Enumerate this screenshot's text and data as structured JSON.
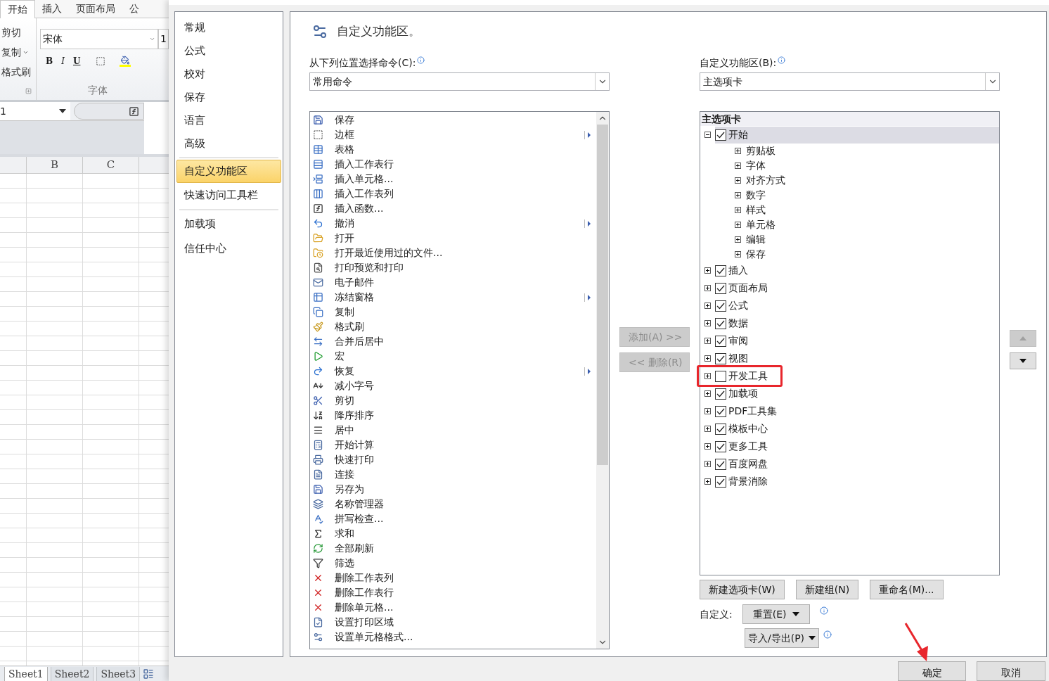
{
  "excel": {
    "ribbon_tabs": [
      {
        "label": "开始",
        "selected": true
      },
      {
        "label": "插入",
        "selected": false
      },
      {
        "label": "页面布局",
        "selected": false
      },
      {
        "label": "公",
        "selected": false
      }
    ],
    "clipboard": [
      "剪切",
      "复制",
      "格式刷"
    ],
    "font": {
      "name": "宋体",
      "size": "1",
      "group_label": "字体"
    },
    "format_buttons": [
      "B",
      "I",
      "U"
    ],
    "name_box": "1",
    "columns": [
      "B",
      "C"
    ],
    "sheet_tabs": [
      {
        "label": "Sheet1",
        "selected": true
      },
      {
        "label": "Sheet2",
        "selected": false
      },
      {
        "label": "Sheet3",
        "selected": false
      }
    ]
  },
  "dialog": {
    "nav": [
      {
        "label": "常规",
        "selected": false
      },
      {
        "label": "公式",
        "selected": false
      },
      {
        "label": "校对",
        "selected": false
      },
      {
        "label": "保存",
        "selected": false
      },
      {
        "label": "语言",
        "selected": false
      },
      {
        "label": "高级",
        "selected": false
      },
      {
        "label": "自定义功能区",
        "selected": true
      },
      {
        "label": "快速访问工具栏",
        "selected": false
      },
      {
        "label": "加载项",
        "selected": false
      },
      {
        "label": "信任中心",
        "selected": false
      }
    ],
    "title": "自定义功能区。",
    "source": {
      "label": "从下列位置选择命令(C):",
      "value": "常用命令"
    },
    "commands": [
      {
        "label": "保存",
        "submenu": false
      },
      {
        "label": "边框",
        "submenu": true
      },
      {
        "label": "表格",
        "submenu": false
      },
      {
        "label": "插入工作表行",
        "submenu": false
      },
      {
        "label": "插入单元格...",
        "submenu": false
      },
      {
        "label": "插入工作表列",
        "submenu": false
      },
      {
        "label": "插入函数...",
        "submenu": false
      },
      {
        "label": "撤消",
        "submenu": true
      },
      {
        "label": "打开",
        "submenu": false
      },
      {
        "label": "打开最近使用过的文件...",
        "submenu": false
      },
      {
        "label": "打印预览和打印",
        "submenu": false
      },
      {
        "label": "电子邮件",
        "submenu": false
      },
      {
        "label": "冻结窗格",
        "submenu": true
      },
      {
        "label": "复制",
        "submenu": false
      },
      {
        "label": "格式刷",
        "submenu": false
      },
      {
        "label": "合并后居中",
        "submenu": false
      },
      {
        "label": "宏",
        "submenu": false
      },
      {
        "label": "恢复",
        "submenu": true
      },
      {
        "label": "减小字号",
        "submenu": false
      },
      {
        "label": "剪切",
        "submenu": false
      },
      {
        "label": "降序排序",
        "submenu": false
      },
      {
        "label": "居中",
        "submenu": false
      },
      {
        "label": "开始计算",
        "submenu": false
      },
      {
        "label": "快速打印",
        "submenu": false
      },
      {
        "label": "连接",
        "submenu": false
      },
      {
        "label": "另存为",
        "submenu": false
      },
      {
        "label": "名称管理器",
        "submenu": false
      },
      {
        "label": "拼写检查...",
        "submenu": false
      },
      {
        "label": "求和",
        "submenu": false
      },
      {
        "label": "全部刷新",
        "submenu": false
      },
      {
        "label": "筛选",
        "submenu": false
      },
      {
        "label": "删除工作表列",
        "submenu": false
      },
      {
        "label": "删除工作表行",
        "submenu": false
      },
      {
        "label": "删除单元格...",
        "submenu": false
      },
      {
        "label": "设置打印区域",
        "submenu": false
      },
      {
        "label": "设置单元格格式...",
        "submenu": false
      }
    ],
    "add_button": {
      "label": "添加(A) >>",
      "disabled": true
    },
    "remove_button": {
      "label": "<< 删除(R)",
      "disabled": true
    },
    "target": {
      "label": "自定义功能区(B):",
      "value": "主选项卡"
    },
    "tree": {
      "header": "主选项卡",
      "items": [
        {
          "label": "开始",
          "checked": true,
          "expanded": true,
          "selected": true,
          "highlighted": false,
          "children": [
            {
              "label": "剪贴板",
              "expanded": false
            },
            {
              "label": "字体",
              "expanded": false
            },
            {
              "label": "对齐方式",
              "expanded": false
            },
            {
              "label": "数字",
              "expanded": false
            },
            {
              "label": "样式",
              "expanded": false
            },
            {
              "label": "单元格",
              "expanded": false
            },
            {
              "label": "编辑",
              "expanded": false
            },
            {
              "label": "保存",
              "expanded": false
            }
          ]
        },
        {
          "label": "插入",
          "checked": true,
          "expanded": false,
          "selected": false,
          "highlighted": false
        },
        {
          "label": "页面布局",
          "checked": true,
          "expanded": false,
          "selected": false,
          "highlighted": false
        },
        {
          "label": "公式",
          "checked": true,
          "expanded": false,
          "selected": false,
          "highlighted": false
        },
        {
          "label": "数据",
          "checked": true,
          "expanded": false,
          "selected": false,
          "highlighted": false
        },
        {
          "label": "审阅",
          "checked": true,
          "expanded": false,
          "selected": false,
          "highlighted": false
        },
        {
          "label": "视图",
          "checked": true,
          "expanded": false,
          "selected": false,
          "highlighted": false
        },
        {
          "label": "开发工具",
          "checked": false,
          "expanded": false,
          "selected": false,
          "highlighted": true
        },
        {
          "label": "加载项",
          "checked": true,
          "expanded": false,
          "selected": false,
          "highlighted": false
        },
        {
          "label": "PDF工具集",
          "checked": true,
          "expanded": false,
          "selected": false,
          "highlighted": false
        },
        {
          "label": "模板中心",
          "checked": true,
          "expanded": false,
          "selected": false,
          "highlighted": false
        },
        {
          "label": "更多工具",
          "checked": true,
          "expanded": false,
          "selected": false,
          "highlighted": false
        },
        {
          "label": "百度网盘",
          "checked": true,
          "expanded": false,
          "selected": false,
          "highlighted": false
        },
        {
          "label": "背景消除",
          "checked": true,
          "expanded": false,
          "selected": false,
          "highlighted": false
        }
      ]
    },
    "move_up": {
      "disabled": true
    },
    "move_down": {
      "disabled": false
    },
    "tree_buttons": [
      "新建选项卡(W)",
      "新建组(N)",
      "重命名(M)..."
    ],
    "customize_label": "自定义:",
    "reset_button": "重置(E)",
    "import_export_button": "导入/导出(P)",
    "ok_button": "确定",
    "cancel_button": "取消"
  }
}
